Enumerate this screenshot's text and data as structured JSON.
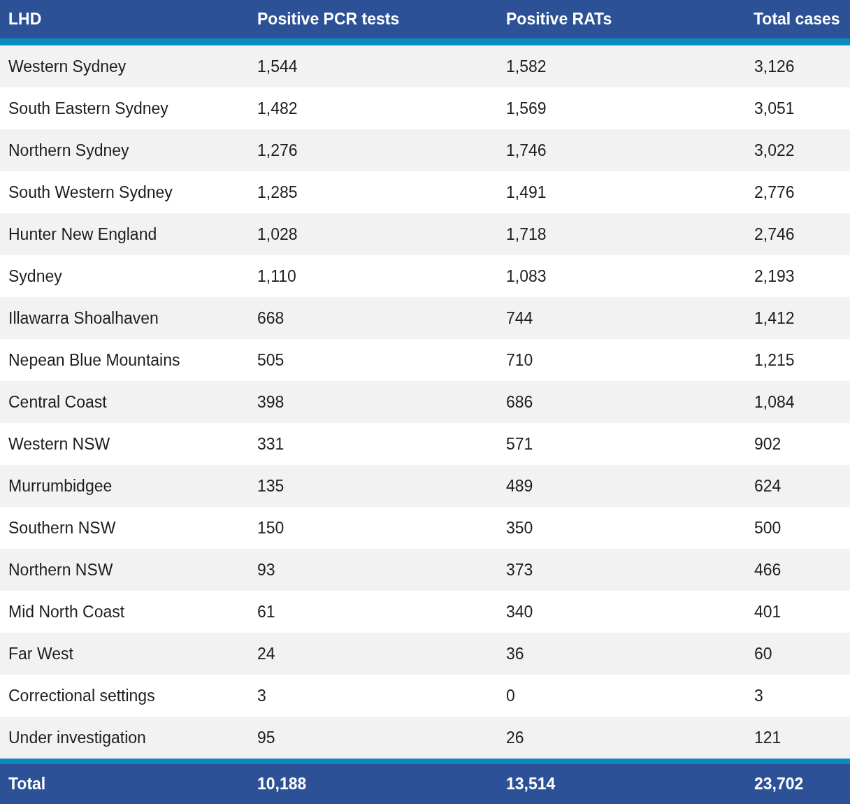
{
  "table": {
    "columns": [
      "LHD",
      "Positive PCR tests",
      "Positive RATs",
      "Total cases"
    ],
    "rows": [
      [
        "Western Sydney",
        "1,544",
        "1,582",
        "3,126"
      ],
      [
        "South Eastern Sydney",
        "1,482",
        "1,569",
        "3,051"
      ],
      [
        "Northern Sydney",
        "1,276",
        "1,746",
        "3,022"
      ],
      [
        "South Western Sydney",
        "1,285",
        "1,491",
        "2,776"
      ],
      [
        "Hunter New England",
        "1,028",
        "1,718",
        "2,746"
      ],
      [
        "Sydney",
        "1,110",
        "1,083",
        "2,193"
      ],
      [
        "Illawarra Shoalhaven",
        "668",
        "744",
        "1,412"
      ],
      [
        "Nepean Blue Mountains",
        "505",
        "710",
        "1,215"
      ],
      [
        "Central Coast",
        "398",
        "686",
        "1,084"
      ],
      [
        "Western NSW",
        "331",
        "571",
        "902"
      ],
      [
        "Murrumbidgee",
        "135",
        "489",
        "624"
      ],
      [
        "Southern NSW",
        "150",
        "350",
        "500"
      ],
      [
        "Northern NSW",
        "93",
        "373",
        "466"
      ],
      [
        "Mid North Coast",
        "61",
        "340",
        "401"
      ],
      [
        "Far West",
        "24",
        "36",
        "60"
      ],
      [
        "Correctional settings",
        "3",
        "0",
        "3"
      ],
      [
        "Under investigation",
        "95",
        "26",
        "121"
      ]
    ],
    "total": [
      "Total",
      "10,188",
      "13,514",
      "23,702"
    ]
  }
}
